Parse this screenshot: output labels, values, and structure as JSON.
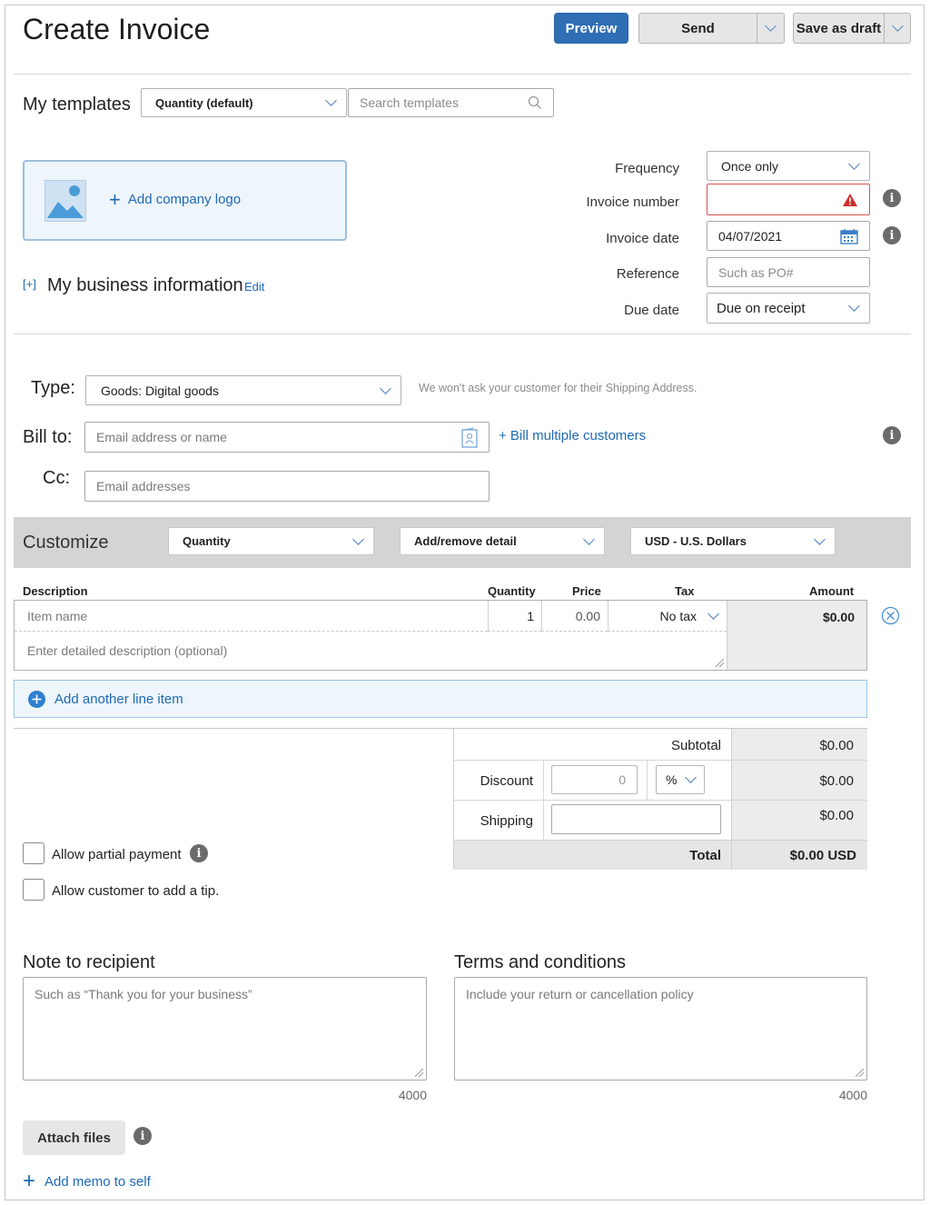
{
  "header": {
    "title": "Create Invoice",
    "preview_label": "Preview",
    "send_label": "Send",
    "save_label": "Save as draft"
  },
  "templates": {
    "label": "My templates",
    "selected": "Quantity (default)",
    "search_placeholder": "Search templates"
  },
  "logo": {
    "add_label": "Add company logo"
  },
  "business": {
    "toggle": "[+]",
    "label": "My business information",
    "edit_label": "Edit"
  },
  "details": {
    "frequency_label": "Frequency",
    "frequency_value": "Once only",
    "invoice_number_label": "Invoice number",
    "invoice_number_value": "",
    "invoice_date_label": "Invoice date",
    "invoice_date_value": "04/07/2021",
    "reference_label": "Reference",
    "reference_placeholder": "Such as PO#",
    "due_date_label": "Due date",
    "due_date_value": "Due on receipt"
  },
  "type": {
    "label": "Type:",
    "value": "Goods: Digital goods",
    "hint": "We won't ask your customer for their Shipping Address."
  },
  "bill_to": {
    "label": "Bill to:",
    "placeholder": "Email address or name",
    "multiple_label": "+ Bill multiple customers"
  },
  "cc": {
    "label": "Cc:",
    "placeholder": "Email addresses"
  },
  "customize": {
    "label": "Customize",
    "quantity_select": "Quantity",
    "detail_select": "Add/remove detail",
    "currency_select": "USD - U.S. Dollars"
  },
  "table": {
    "headers": {
      "description": "Description",
      "quantity": "Quantity",
      "price": "Price",
      "tax": "Tax",
      "amount": "Amount"
    },
    "item": {
      "name_placeholder": "Item name",
      "quantity": "1",
      "price": "0.00",
      "tax": "No tax",
      "amount": "$0.00",
      "description_placeholder": "Enter detailed description (optional)"
    },
    "add_line_label": "Add another line item"
  },
  "totals": {
    "subtotal_label": "Subtotal",
    "subtotal_value": "$0.00",
    "discount_label": "Discount",
    "discount_input": "0",
    "discount_unit": "%",
    "discount_value": "$0.00",
    "shipping_label": "Shipping",
    "shipping_value": "$0.00",
    "total_label": "Total",
    "total_value": "$0.00 USD"
  },
  "options": {
    "partial_payment_label": "Allow partial payment",
    "tip_label": "Allow customer to add a tip."
  },
  "note": {
    "label": "Note to recipient",
    "placeholder": "Such as “Thank you for your business”",
    "limit": "4000"
  },
  "terms": {
    "label": "Terms and conditions",
    "placeholder": "Include your return or cancellation policy",
    "limit": "4000"
  },
  "footer": {
    "attach_label": "Attach files",
    "memo_label": "Add memo to self"
  },
  "colors": {
    "accent": "#2f6db5",
    "link": "#1f69b3",
    "error": "#c9302c",
    "customize_bg": "#d4d4d4"
  }
}
